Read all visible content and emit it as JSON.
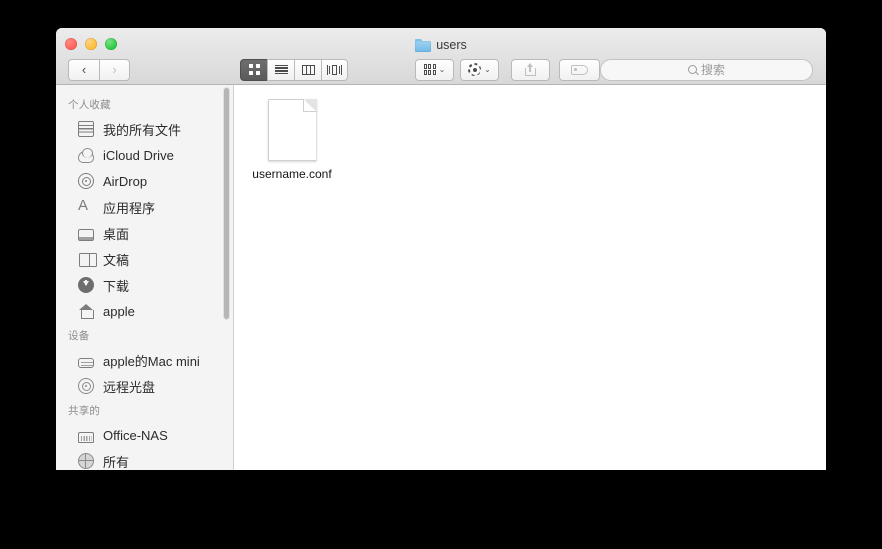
{
  "window": {
    "title": "users",
    "title_icon": "folder-icon"
  },
  "traffic_lights": [
    {
      "name": "close-button",
      "color": "#ff5f57"
    },
    {
      "name": "minimize-button",
      "color": "#febc2e"
    },
    {
      "name": "maximize-button",
      "color": "#28c840"
    }
  ],
  "toolbar": {
    "back_label": "‹",
    "forward_label": "›",
    "view_modes": [
      {
        "name": "icon-view-button",
        "icon": "grid-icon",
        "active": true
      },
      {
        "name": "list-view-button",
        "icon": "list-icon",
        "active": false
      },
      {
        "name": "column-view-button",
        "icon": "columns-icon",
        "active": false
      },
      {
        "name": "coverflow-view-button",
        "icon": "coverflow-icon",
        "active": false
      }
    ],
    "arrange_icon": "arrange-grid-icon",
    "action_icon": "gear-icon",
    "share_icon": "share-icon",
    "tag_icon": "tag-icon",
    "chevron": "⌄"
  },
  "search": {
    "placeholder": "搜索",
    "value": "",
    "icon": "search-icon"
  },
  "sidebar": {
    "sections": [
      {
        "title": "个人收藏",
        "items": [
          {
            "label": "我的所有文件",
            "icon": "all-files-icon"
          },
          {
            "label": "iCloud Drive",
            "icon": "cloud-icon"
          },
          {
            "label": "AirDrop",
            "icon": "airdrop-icon"
          },
          {
            "label": "应用程序",
            "icon": "applications-icon"
          },
          {
            "label": "桌面",
            "icon": "desktop-icon"
          },
          {
            "label": "文稿",
            "icon": "documents-icon"
          },
          {
            "label": "下载",
            "icon": "downloads-icon"
          },
          {
            "label": "apple",
            "icon": "home-icon"
          }
        ]
      },
      {
        "title": "设备",
        "items": [
          {
            "label": "apple的Mac mini",
            "icon": "mac-mini-icon"
          },
          {
            "label": "远程光盘",
            "icon": "optical-disc-icon"
          }
        ]
      },
      {
        "title": "共享的",
        "items": [
          {
            "label": "Office-NAS",
            "icon": "nas-server-icon"
          },
          {
            "label": "所有",
            "icon": "globe-icon"
          }
        ]
      }
    ]
  },
  "content": {
    "files": [
      {
        "name": "username.conf",
        "icon": "document-icon",
        "selected": false
      }
    ]
  }
}
